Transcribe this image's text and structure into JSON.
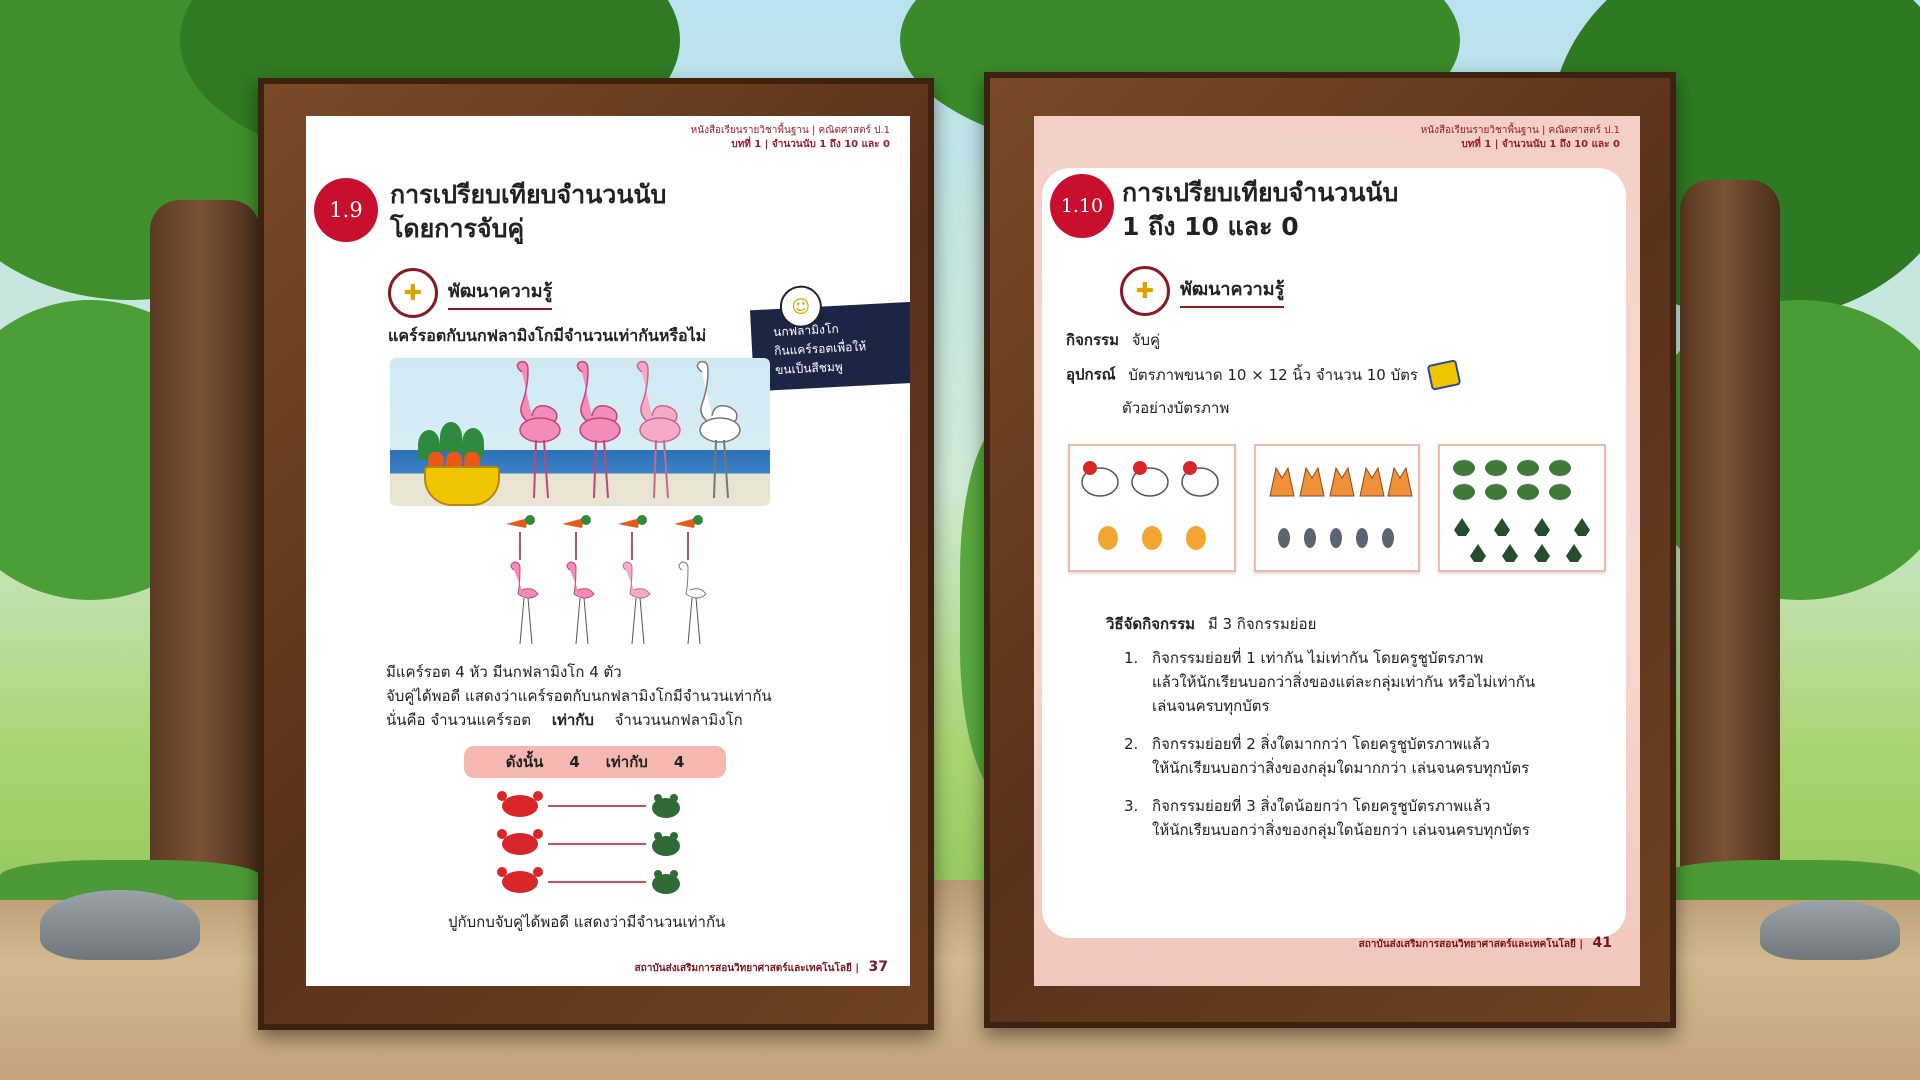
{
  "left_page": {
    "header_line1": "หนังสือเรียนรายวิชาพื้นฐาน | คณิตศาสตร์ ป.1",
    "header_line2": "บทที่ 1 | จำนวนนับ 1 ถึง 10 และ 0",
    "lesson_number": "1.9",
    "title_line1": "การเปรียบเทียบจำนวนนับ",
    "title_line2": "โดยการจับคู่",
    "section_label": "พัฒนาความรู้",
    "question": "แคร์รอตกับนกฟลามิงโกมีจำนวนเท่ากันหรือไม่",
    "note": [
      "นกฟลามิงโก",
      "กินแคร์รอตเพื่อให้",
      "ขนเป็นสีชมพู"
    ],
    "text_line1": "มีแคร์รอต   4  หัว   มีนกฟลามิงโก  4 ตัว",
    "text_line2": "จับคู่ได้พอดี  แสดงว่าแคร์รอตกับนกฟลามิงโกมีจำนวนเท่ากัน",
    "text_line3_a": "นั่นคือ     จำนวนแคร์รอต",
    "text_line3_b": "เท่ากับ",
    "text_line3_c": "จำนวนนกฟลามิงโก",
    "conclusion": {
      "label": "ดังนั้น",
      "a": "4",
      "eq": "เท่ากับ",
      "b": "4"
    },
    "crab_caption": "ปูกับกบจับคู่ได้พอดี แสดงว่ามีจำนวนเท่ากัน",
    "footer_text": "สถาบันส่งเสริมการสอนวิทยาศาสตร์และเทคโนโลยี",
    "page_number": "37"
  },
  "right_page": {
    "header_line1": "หนังสือเรียนรายวิชาพื้นฐาน | คณิตศาสตร์ ป.1",
    "header_line2": "บทที่ 1 | จำนวนนับ 1 ถึง 10 และ 0",
    "lesson_number": "1.10",
    "title_line1": "การเปรียบเทียบจำนวนนับ",
    "title_line2": "1 ถึง 10 และ 0",
    "section_label": "พัฒนาความรู้",
    "activity_label": "กิจกรรม",
    "activity_value": "จับคู่",
    "equipment_label": "อุปกรณ์",
    "equipment_value": "บัตรภาพขนาด 10 × 12 นิ้ว จำนวน 10 บัตร",
    "sample_label": "ตัวอย่างบัตรภาพ",
    "method_label": "วิธีจัดกิจกรรม",
    "method_value": "มี 3 กิจกรรมย่อย",
    "steps": [
      {
        "num": "1.",
        "line1": "กิจกรรมย่อยที่ 1 เท่ากัน ไม่เท่ากัน โดยครูชูบัตรภาพ",
        "line2": "แล้วให้นักเรียนบอกว่าสิ่งของแต่ละกลุ่มเท่ากัน หรือไม่เท่ากัน",
        "line3": "เล่นจนครบทุกบัตร"
      },
      {
        "num": "2.",
        "line1": "กิจกรรมย่อยที่ 2 สิ่งใดมากกว่า โดยครูชูบัตรภาพแล้ว",
        "line2": "ให้นักเรียนบอกว่าสิ่งของกลุ่มใดมากกว่า เล่นจนครบทุกบัตร"
      },
      {
        "num": "3.",
        "line1": "กิจกรรมย่อยที่ 3 สิ่งใดน้อยกว่า โดยครูชูบัตรภาพแล้ว",
        "line2": "ให้นักเรียนบอกว่าสิ่งของกลุ่มใดน้อยกว่า เล่นจนครบทุกบัตร"
      }
    ],
    "footer_text": "สถาบันส่งเสริมการสอนวิทยาศาสตร์และเทคโนโลยี",
    "page_number": "41"
  },
  "colors": {
    "accent_red": "#c8102e",
    "note_navy": "#1c2545",
    "pink_bar": "#f5b8b0"
  },
  "icons": [
    "brain-head-icon",
    "flamingo-face-icon",
    "cards-icon"
  ]
}
